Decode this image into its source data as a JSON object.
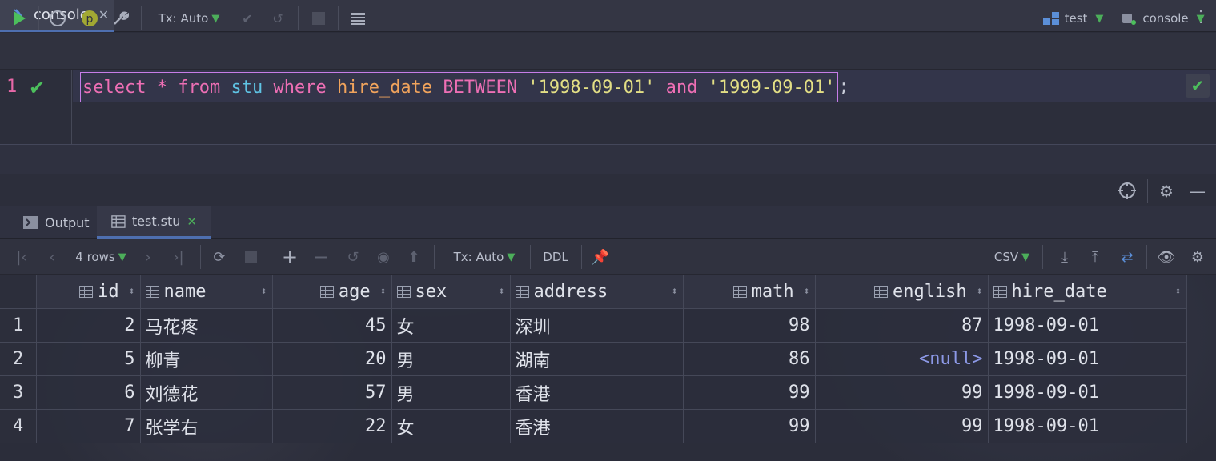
{
  "tab": {
    "label": "console",
    "close": "✕"
  },
  "toolbar": {
    "tx_mode": "Tx: Auto",
    "datasource": "test",
    "session": "console"
  },
  "editor": {
    "line_number": "1",
    "tokens": [
      {
        "t": "select",
        "c": "kw"
      },
      {
        "t": " * ",
        "c": "kw"
      },
      {
        "t": "from",
        "c": "kw"
      },
      {
        "t": " ",
        "c": "plain"
      },
      {
        "t": "stu",
        "c": "tbl"
      },
      {
        "t": " ",
        "c": "plain"
      },
      {
        "t": "where",
        "c": "kw"
      },
      {
        "t": " ",
        "c": "plain"
      },
      {
        "t": "hire_date",
        "c": "col"
      },
      {
        "t": " ",
        "c": "plain"
      },
      {
        "t": "BETWEEN",
        "c": "kw"
      },
      {
        "t": " ",
        "c": "plain"
      },
      {
        "t": "'1998-09-01'",
        "c": "str"
      },
      {
        "t": " ",
        "c": "plain"
      },
      {
        "t": "and",
        "c": "kw"
      },
      {
        "t": " ",
        "c": "plain"
      },
      {
        "t": "'1999-09-01'",
        "c": "str"
      }
    ],
    "terminator": ";"
  },
  "results_tabs": {
    "output": "Output",
    "table": "test.stu",
    "close": "✕"
  },
  "result_toolbar": {
    "rows": "4 rows",
    "tx_mode": "Tx: Auto",
    "ddl": "DDL",
    "export": "CSV"
  },
  "columns": [
    "id",
    "name",
    "age",
    "sex",
    "address",
    "math",
    "english",
    "hire_date"
  ],
  "rows": [
    {
      "n": "1",
      "id": "2",
      "name": "马花疼",
      "age": "45",
      "sex": "女",
      "address": "深圳",
      "math": "98",
      "english": "87",
      "hire_date": "1998-09-01"
    },
    {
      "n": "2",
      "id": "5",
      "name": "柳青",
      "age": "20",
      "sex": "男",
      "address": "湖南",
      "math": "86",
      "english": "<null>",
      "hire_date": "1998-09-01"
    },
    {
      "n": "3",
      "id": "6",
      "name": "刘德花",
      "age": "57",
      "sex": "男",
      "address": "香港",
      "math": "99",
      "english": "99",
      "hire_date": "1998-09-01"
    },
    {
      "n": "4",
      "id": "7",
      "name": "张学右",
      "age": "22",
      "sex": "女",
      "address": "香港",
      "math": "99",
      "english": "99",
      "hire_date": "1998-09-01"
    }
  ]
}
